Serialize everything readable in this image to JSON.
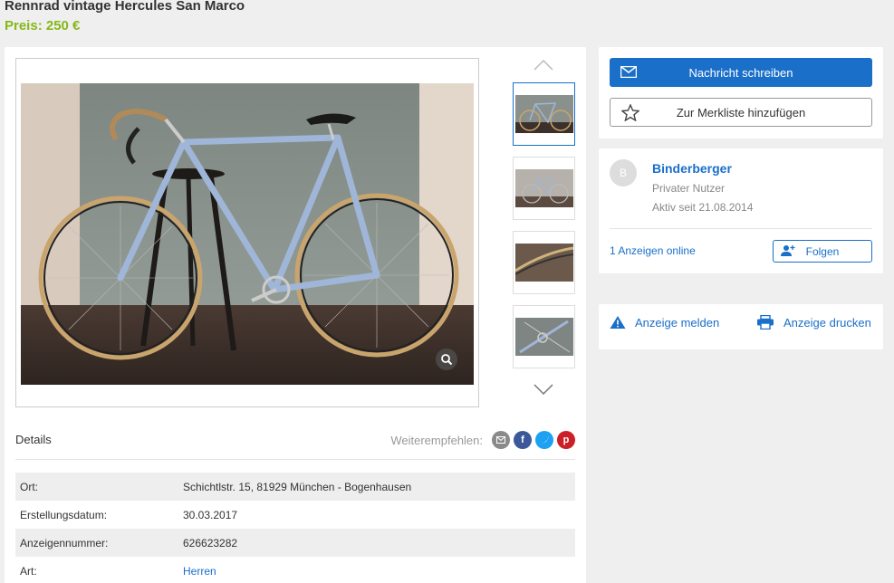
{
  "listing": {
    "title": "Rennrad vintage Hercules San Marco",
    "price": "Preis: 250 €"
  },
  "details": {
    "heading": "Details",
    "share_label": "Weiterempfehlen:",
    "rows": [
      {
        "label": "Ort:",
        "value": "Schichtlstr. 15, 81929 München - Bogenhausen"
      },
      {
        "label": "Erstellungsdatum:",
        "value": "30.03.2017"
      },
      {
        "label": "Anzeigennummer:",
        "value": "626623282"
      },
      {
        "label": "Art:",
        "value": "Herren"
      }
    ]
  },
  "share_icons": [
    "email-icon",
    "facebook-icon",
    "twitter-icon",
    "pinterest-icon"
  ],
  "actions": {
    "message_label": "Nachricht schreiben",
    "watchlist_label": "Zur Merkliste hinzufügen"
  },
  "seller": {
    "initial": "B",
    "name": "Binderberger",
    "type": "Privater Nutzer",
    "since": "Aktiv seit 21.08.2014",
    "ads_online": "1 Anzeigen online",
    "follow_label": "Folgen"
  },
  "report": {
    "report_label": "Anzeige melden",
    "print_label": "Anzeige drucken"
  },
  "colors": {
    "accent": "#1a6fc9",
    "price": "#86b817",
    "bike_frame": "#9fb6d8"
  }
}
